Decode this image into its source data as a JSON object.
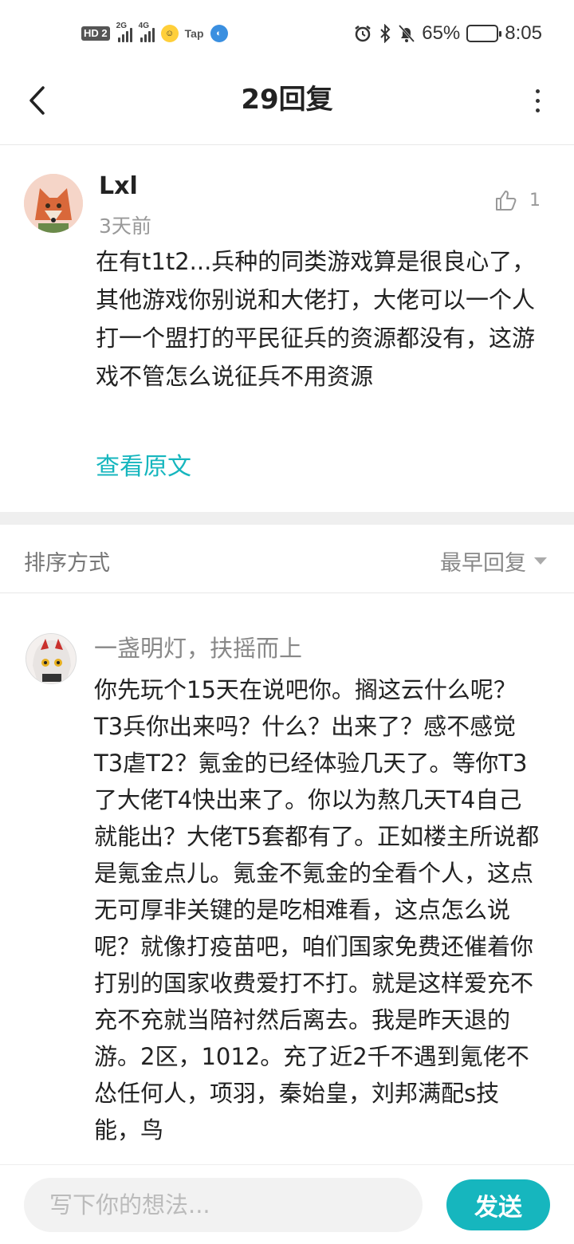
{
  "status_bar": {
    "hd": "HD",
    "sim_badge": "2",
    "net1": "2G",
    "net2": "4G",
    "app_tap": "Tap",
    "battery_percent": "65%",
    "battery_level": 0.65,
    "time": "8:05"
  },
  "header": {
    "title": "29回复"
  },
  "main_comment": {
    "username": "Lxl",
    "time": "3天前",
    "like_count": "1",
    "content": "在有t1t2...兵种的同类游戏算是很良心了，其他游戏你别说和大佬打，大佬可以一个人打一个盟打的平民征兵的资源都没有，这游戏不管怎么说征兵不用资源",
    "view_original": "查看原文"
  },
  "sort": {
    "label": "排序方式",
    "selected": "最早回复"
  },
  "reply": {
    "username": "一盏明灯，扶摇而上",
    "content": "你先玩个15天在说吧你。搁这云什么呢？\nT3兵你出来吗？什么？出来了？感不感觉T3虐T2？氪金的已经体验几天了。等你T3了大佬T4快出来了。你以为熬几天T4自己就能出？大佬T5套都有了。正如楼主所说都是氪金点儿。氪金不氪金的全看个人，这点无可厚非关键的是吃相难看，这点怎么说呢？就像打疫苗吧，咱们国家免费还催着你打别的国家收费爱打不打。就是这样爱充不充不充就当陪衬然后离去。我是昨天退的游。2区，1012。充了近2千不遇到氪佬不怂任何人，项羽，秦始皇，刘邦满配s技能，鸟"
  },
  "input": {
    "placeholder": "写下你的想法...",
    "send_label": "发送"
  },
  "colors": {
    "accent": "#16b6be",
    "muted_text": "#999999",
    "divider_band": "#efefef"
  }
}
